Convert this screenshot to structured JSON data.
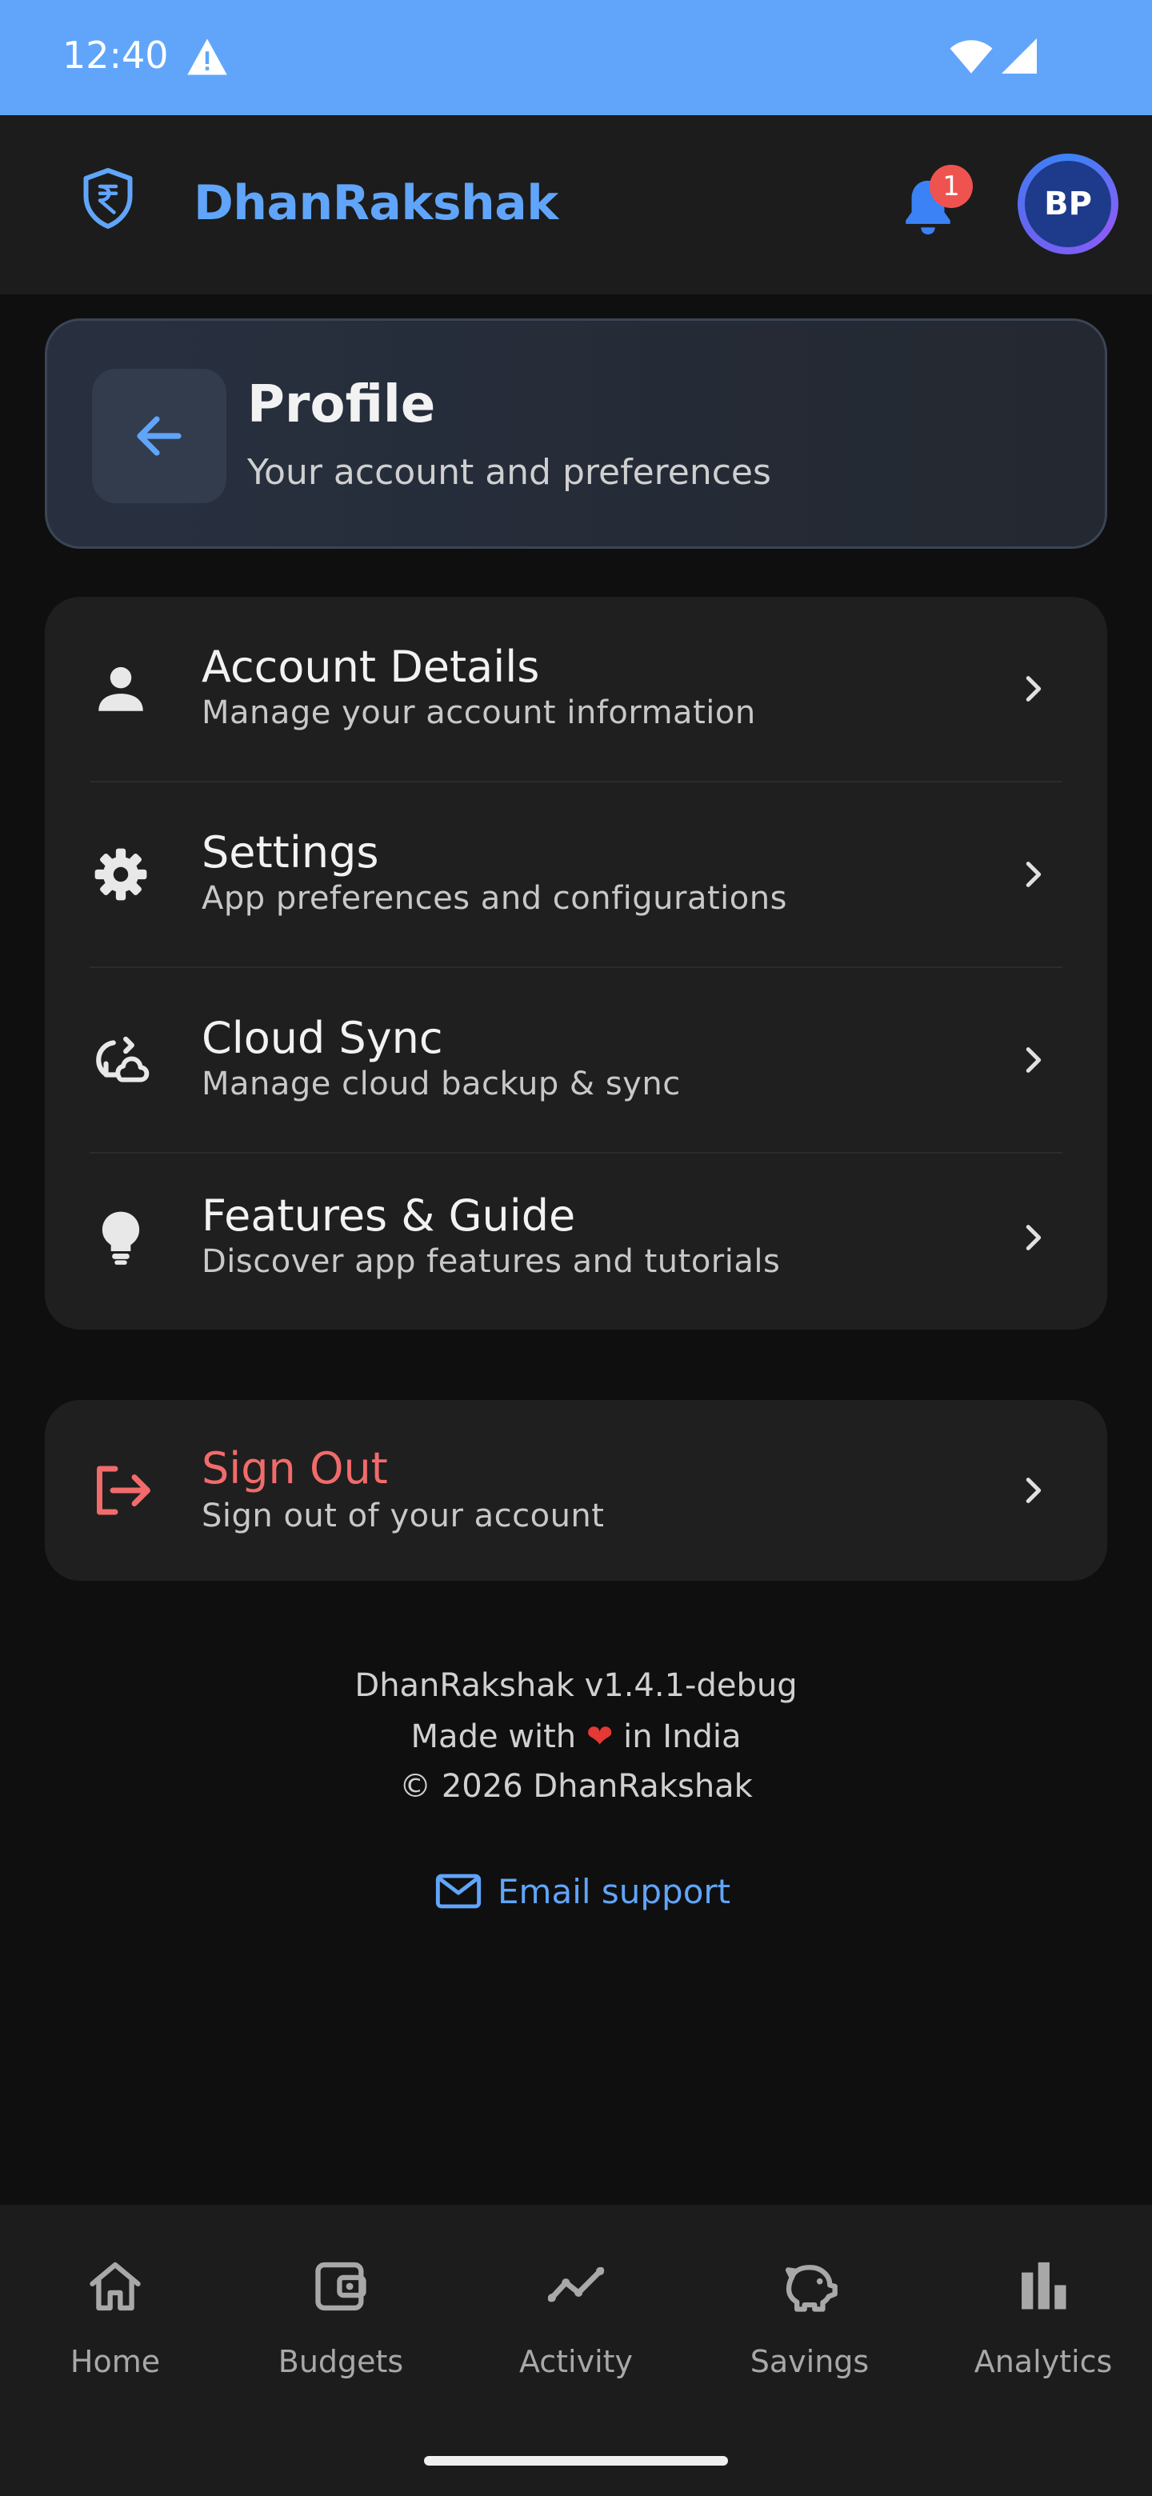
{
  "status_bar": {
    "time": "12:40"
  },
  "header": {
    "brand": "DhanRakshak",
    "notification_count": "1",
    "avatar_initials": "BP"
  },
  "profile": {
    "title": "Profile",
    "subtitle": "Your account and preferences"
  },
  "menu": [
    {
      "title": "Account Details",
      "subtitle": "Manage your account information",
      "icon": "person-icon"
    },
    {
      "title": "Settings",
      "subtitle": "App preferences and configurations",
      "icon": "gear-icon"
    },
    {
      "title": "Cloud Sync",
      "subtitle": "Manage cloud backup & sync",
      "icon": "cloud-sync-icon"
    },
    {
      "title": "Features & Guide",
      "subtitle": "Discover app features and tutorials",
      "icon": "lightbulb-icon"
    }
  ],
  "signout": {
    "title": "Sign Out",
    "subtitle": "Sign out of your account"
  },
  "footer": {
    "version": "DhanRakshak v1.4.1-debug",
    "made_prefix": "Made with",
    "heart": "❤",
    "made_suffix": "in India",
    "copyright": "© 2026 DhanRakshak",
    "email_support": "Email support"
  },
  "nav": [
    {
      "label": "Home",
      "icon": "home-icon"
    },
    {
      "label": "Budgets",
      "icon": "wallet-icon"
    },
    {
      "label": "Activity",
      "icon": "activity-icon"
    },
    {
      "label": "Savings",
      "icon": "piggy-bank-icon"
    },
    {
      "label": "Analytics",
      "icon": "bar-chart-icon"
    }
  ],
  "colors": {
    "accent": "#60a5fa",
    "danger": "#f26b6b",
    "status_bar": "#60a5fa"
  }
}
